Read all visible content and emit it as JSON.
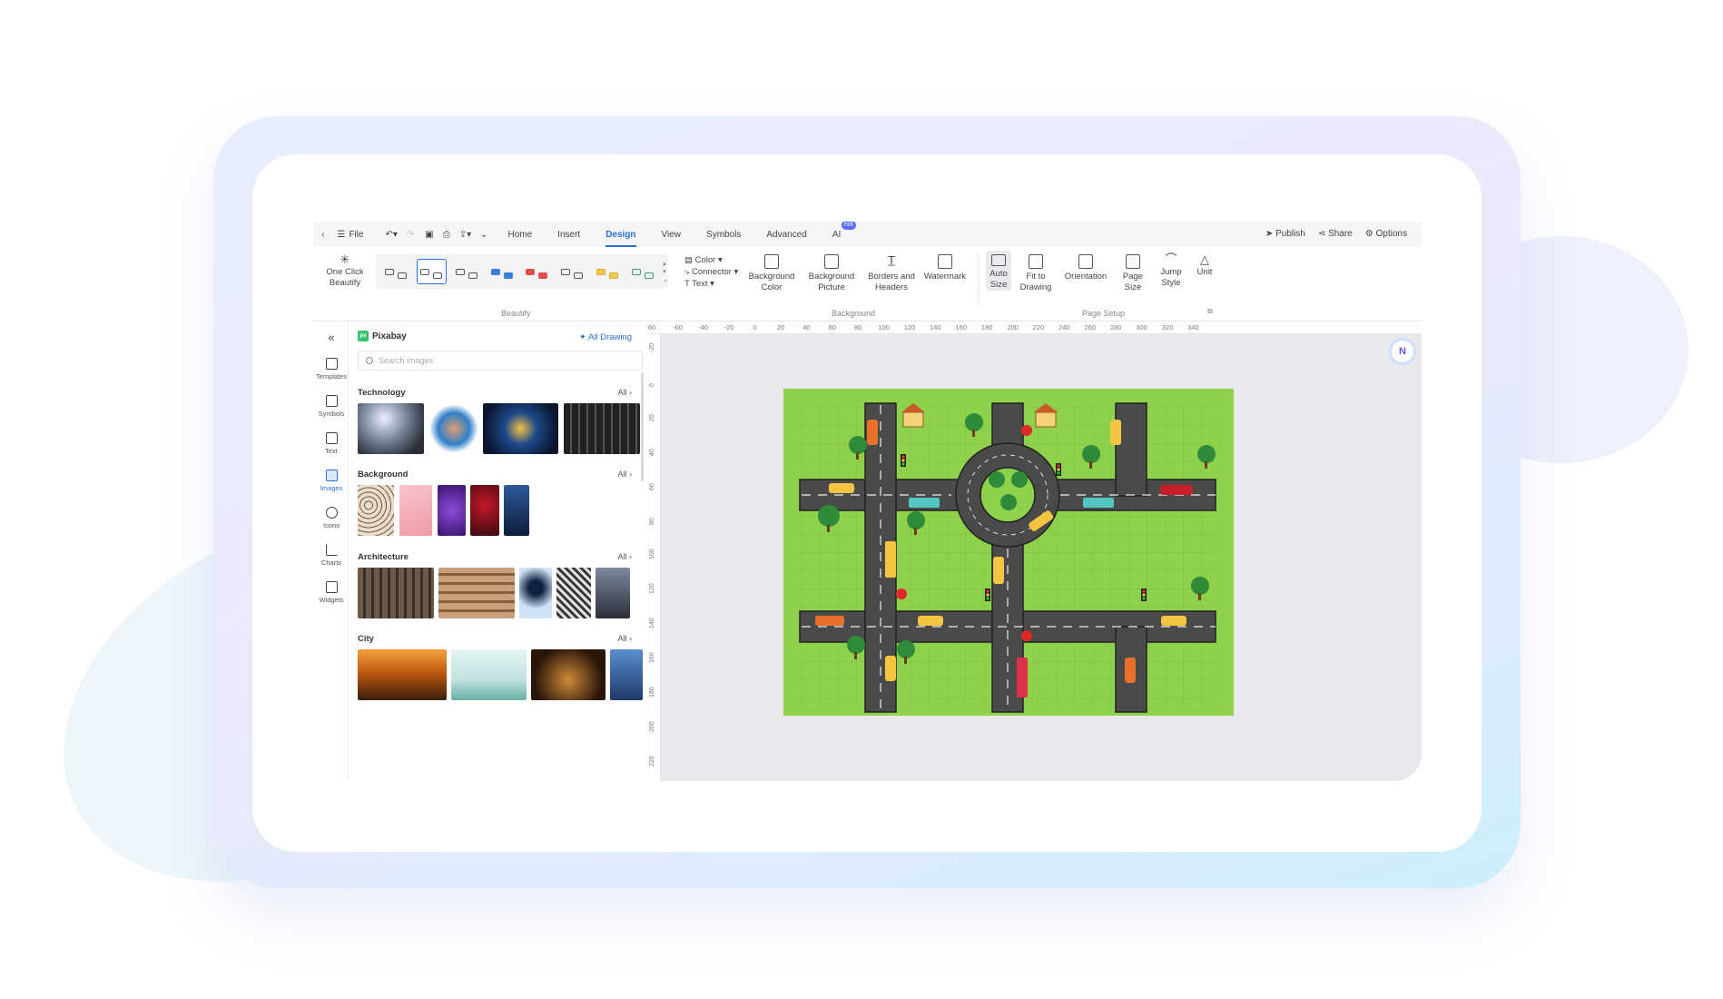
{
  "menubar": {
    "file_label": "File",
    "tabs": [
      {
        "label": "Home"
      },
      {
        "label": "Insert"
      },
      {
        "label": "Design"
      },
      {
        "label": "View"
      },
      {
        "label": "Symbols"
      },
      {
        "label": "Advanced"
      },
      {
        "label": "AI"
      }
    ],
    "active_tab": "Design",
    "ai_badge": "hot",
    "actions": {
      "publish": "Publish",
      "share": "Share",
      "options": "Options"
    }
  },
  "ribbon": {
    "one_click_beautify": "One Click Beautify",
    "beautify_group": "Beautify",
    "color": "Color",
    "connector": "Connector",
    "text": "Text",
    "background_color": "Background Color",
    "background_picture": "Background Picture",
    "borders_and_headers": "Borders and Headers",
    "watermark": "Watermark",
    "background_group": "Background",
    "auto_size": "Auto Size",
    "fit_to_drawing": "Fit to Drawing",
    "orientation": "Orientation",
    "page_size": "Page Size",
    "jump_style": "Jump Style",
    "unit": "Unit",
    "page_setup_group": "Page Setup"
  },
  "rail": [
    {
      "label": "Templates",
      "icon": "templates-icon"
    },
    {
      "label": "Symbols",
      "icon": "symbols-icon"
    },
    {
      "label": "Text",
      "icon": "text-icon"
    },
    {
      "label": "Images",
      "icon": "images-icon",
      "active": true
    },
    {
      "label": "Icons",
      "icon": "icons-icon"
    },
    {
      "label": "Charts",
      "icon": "charts-icon"
    },
    {
      "label": "Widgets",
      "icon": "widgets-icon"
    }
  ],
  "panel": {
    "source": "Pixabay",
    "all_drawing": "All Drawing",
    "search_placeholder": "Search images",
    "sections": [
      {
        "title": "Technology",
        "all": "All"
      },
      {
        "title": "Background",
        "all": "All"
      },
      {
        "title": "Architecture",
        "all": "All"
      },
      {
        "title": "City",
        "all": "All"
      }
    ]
  },
  "ruler_top": [
    "80",
    "-60",
    "-40",
    "-20",
    "0",
    "20",
    "40",
    "60",
    "80",
    "100",
    "120",
    "140",
    "160",
    "180",
    "200",
    "220",
    "240",
    "260",
    "280",
    "300",
    "320",
    "340"
  ],
  "ruler_left": [
    "-20",
    "0",
    "20",
    "40",
    "60",
    "80",
    "100",
    "120",
    "140",
    "160",
    "180",
    "200",
    "220"
  ],
  "colors": {
    "accent": "#2b6fd6",
    "map_grass": "#8ed14b",
    "road": "#4a4a4a"
  }
}
